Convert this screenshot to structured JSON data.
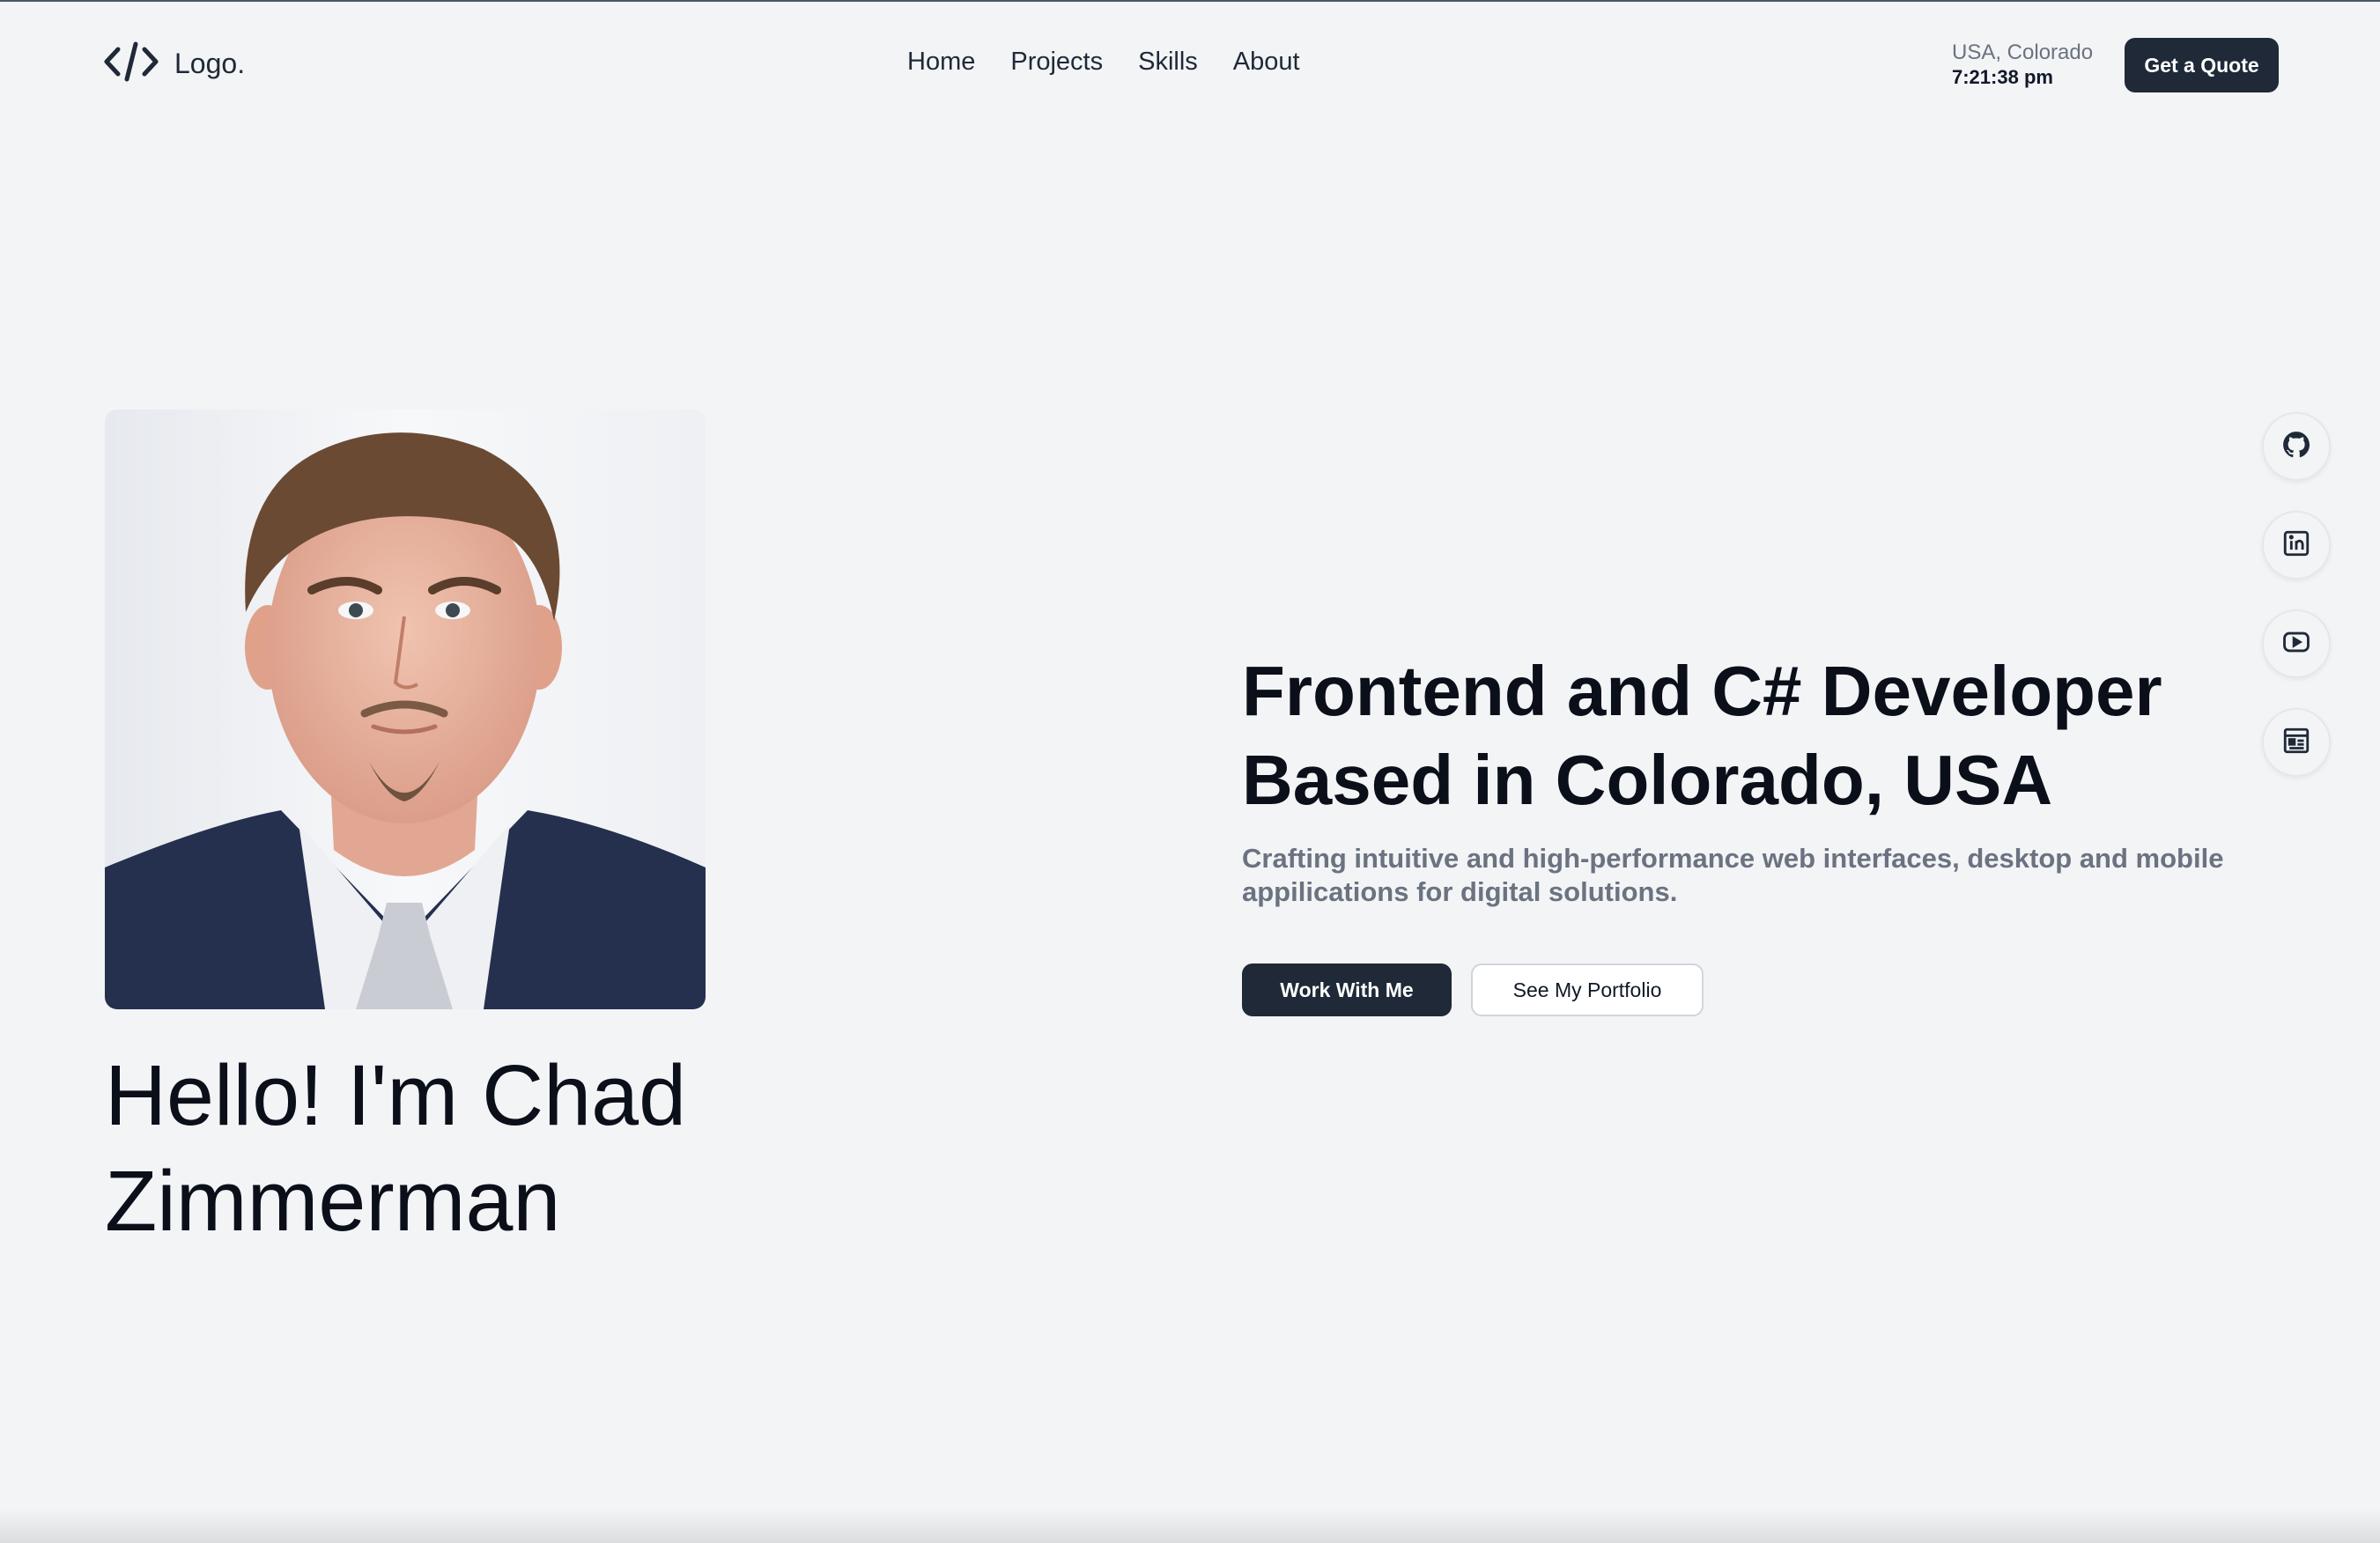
{
  "header": {
    "logo_text": "Logo.",
    "logo_icon": "code-icon",
    "nav": [
      {
        "label": "Home"
      },
      {
        "label": "Projects"
      },
      {
        "label": "Skills"
      },
      {
        "label": "About"
      }
    ],
    "location": "USA, Colorado",
    "time": "7:21:38 pm",
    "quote_button": "Get a Quote"
  },
  "hero": {
    "greeting": "Hello! I'm Chad Zimmerman",
    "headline": "Frontend and C# Developer Based in Colorado, USA",
    "subheadline": "Crafting intuitive and high-performance web interfaces, desktop and mobile appilications for digital solutions.",
    "primary_button": "Work With Me",
    "secondary_button": "See My Portfolio"
  },
  "social": [
    {
      "icon": "github-icon"
    },
    {
      "icon": "linkedin-icon"
    },
    {
      "icon": "youtube-icon"
    },
    {
      "icon": "blog-icon"
    }
  ],
  "colors": {
    "background": "#f3f4f6",
    "dark_button": "#1f2937",
    "muted_text": "#6b7280"
  }
}
